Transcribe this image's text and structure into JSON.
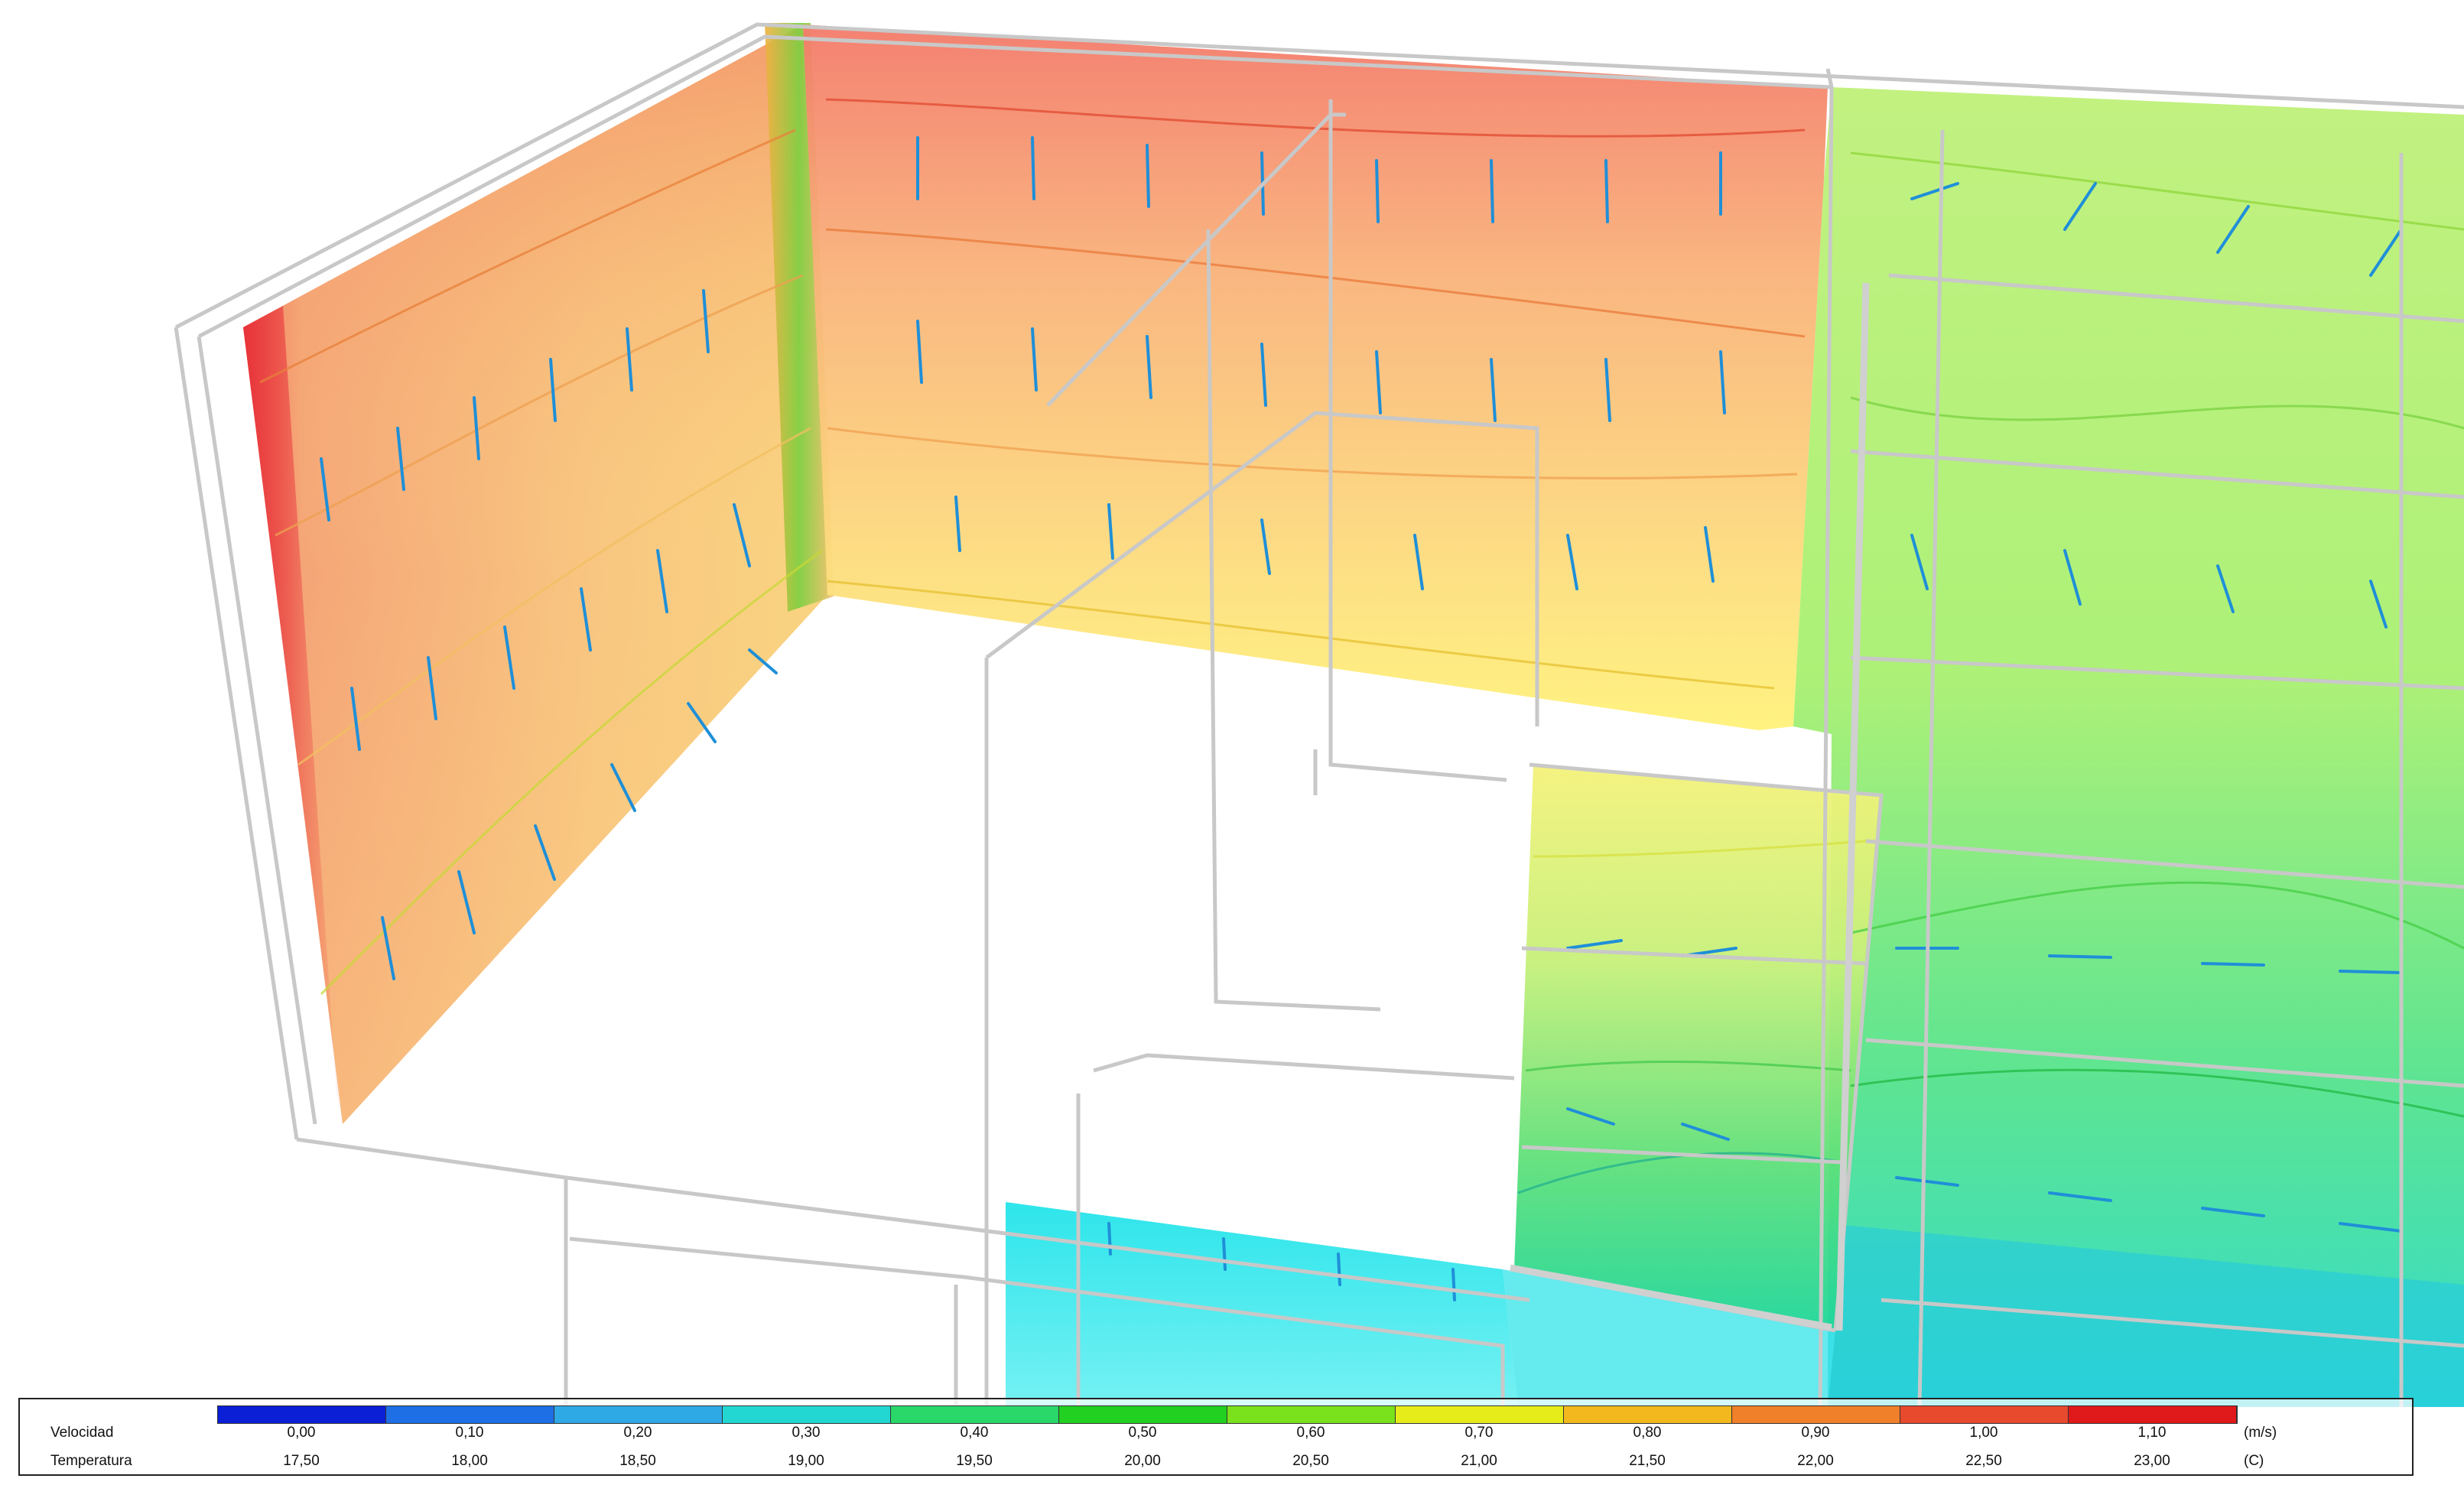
{
  "legend": {
    "velocity_label": "Velocidad",
    "temperature_label": "Temperatura",
    "velocity_unit": "(m/s)",
    "temperature_unit": "(C)",
    "colors": [
      "#0a1fd6",
      "#1e6ee6",
      "#2fa8e6",
      "#22d7d2",
      "#2ad86a",
      "#21d021",
      "#79e21c",
      "#e6ec1a",
      "#f2b81d",
      "#f0802a",
      "#e84a2e",
      "#e01a1a"
    ],
    "velocity_ticks": [
      "0,00",
      "0,10",
      "0,20",
      "0,30",
      "0,40",
      "0,50",
      "0,60",
      "0,70",
      "0,80",
      "0,90",
      "1,00",
      "1,10"
    ],
    "temperature_ticks": [
      "17,50",
      "18,00",
      "18,50",
      "19,00",
      "19,50",
      "20,00",
      "20,50",
      "21,00",
      "21,50",
      "22,00",
      "22,50",
      "23,00"
    ]
  }
}
